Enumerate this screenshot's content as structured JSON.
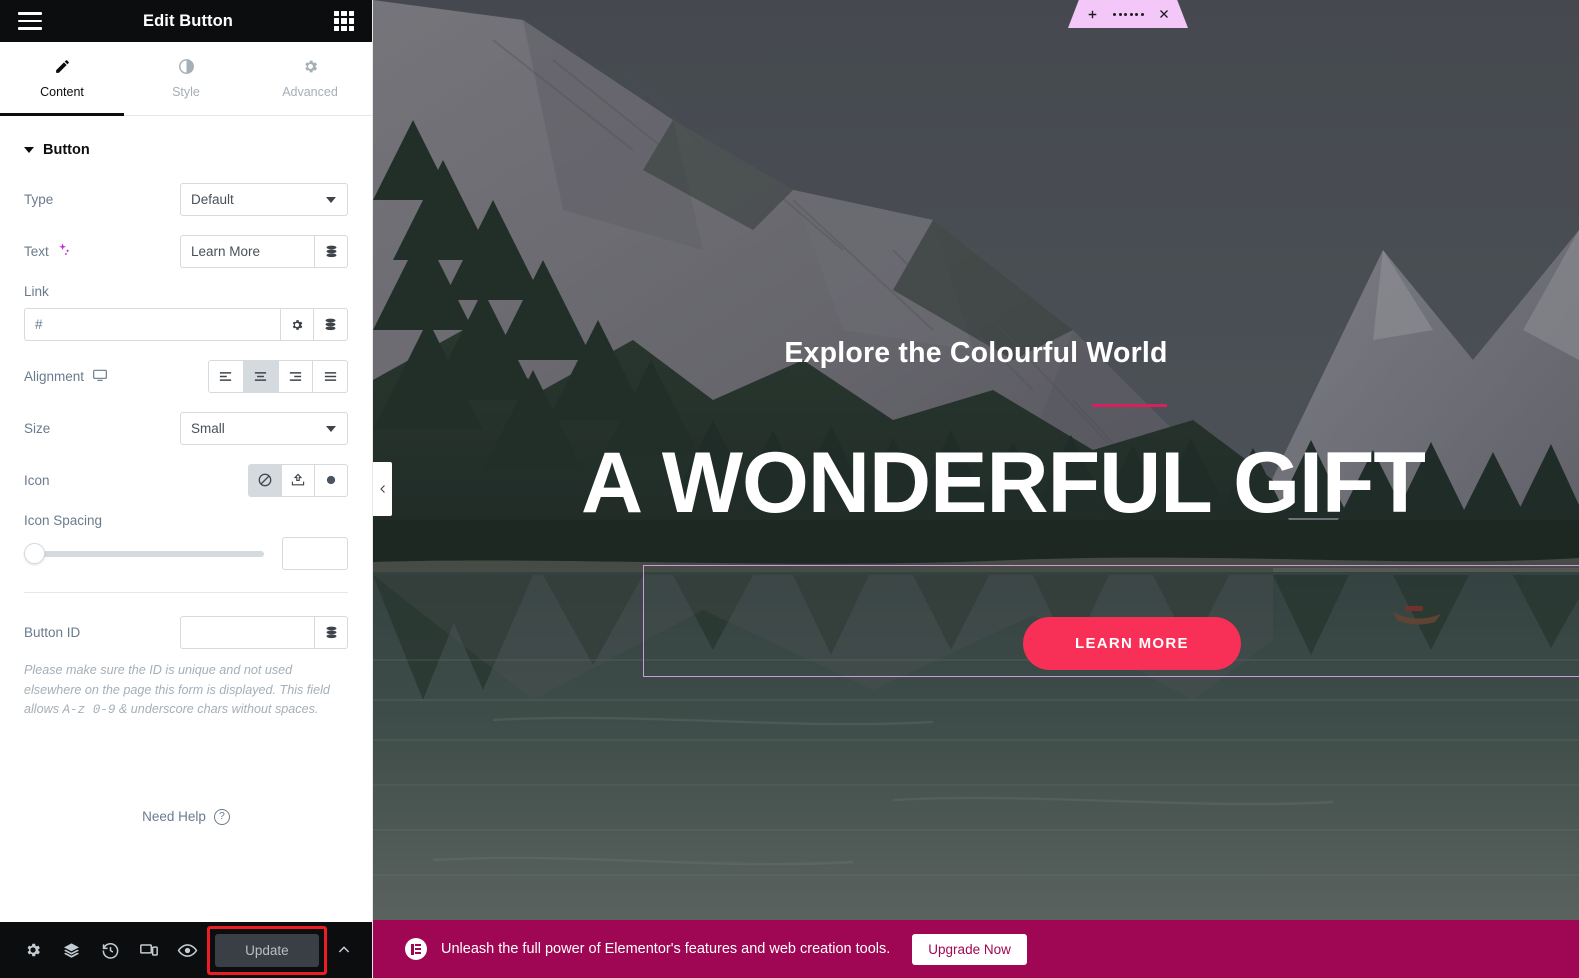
{
  "sidebar": {
    "header": {
      "title": "Edit Button",
      "menu_icon": "hamburger-icon",
      "apps_icon": "grid-apps-icon"
    },
    "tabs": [
      {
        "label": "Content",
        "icon": "pencil-icon",
        "active": true
      },
      {
        "label": "Style",
        "icon": "contrast-half-circle-icon",
        "active": false
      },
      {
        "label": "Advanced",
        "icon": "gear-icon",
        "active": false
      }
    ],
    "section": {
      "title": "Button",
      "expanded": true
    },
    "fields": {
      "type": {
        "label": "Type",
        "value": "Default"
      },
      "text": {
        "label": "Text",
        "value": "Learn More",
        "ai_icon": "ai-sparkles-icon",
        "dynamic_icon": "dynamic-tags-icon"
      },
      "link": {
        "label": "Link",
        "value": "#",
        "settings_icon": "gear-icon",
        "dynamic_icon": "dynamic-tags-icon"
      },
      "alignment": {
        "label": "Alignment",
        "device_icon": "desktop-icon",
        "options": [
          "align-left",
          "align-center",
          "align-right",
          "align-justify"
        ],
        "selected": "align-center"
      },
      "size": {
        "label": "Size",
        "value": "Small"
      },
      "icon": {
        "label": "Icon",
        "options": [
          "icon-none-ban",
          "icon-upload",
          "icon-circle"
        ],
        "selected": "icon-none-ban"
      },
      "icon_spacing": {
        "label": "Icon Spacing",
        "value": "",
        "slider_position_percent": 0
      },
      "button_id": {
        "label": "Button ID",
        "value": "",
        "placeholder": "",
        "dynamic_icon": "dynamic-tags-icon"
      }
    },
    "help_text": {
      "part1": "Please make sure the ID is unique and not used elsewhere on the page this form is displayed. This field allows",
      "mono": "A-z 0-9",
      "part2": "& underscore chars without spaces."
    },
    "need_help": {
      "label": "Need Help",
      "icon": "question-circle-icon"
    },
    "footer": {
      "icons": [
        "gear-icon",
        "layers-icon",
        "history-revisions-icon",
        "responsive-device-icon",
        "eye-preview-icon"
      ],
      "update_label": "Update",
      "update_highlight_color": "#ee1c25",
      "expand_icon": "chevron-up-icon"
    }
  },
  "canvas": {
    "section_toolbar": {
      "add_icon": "plus-icon",
      "drag_icon": "drag-dots-icon",
      "close_icon": "close-x-icon",
      "color": "#f3c7f7"
    },
    "collapse_panel": {
      "icon": "chevron-left-icon"
    },
    "hero": {
      "subtitle": "Explore the Colourful World",
      "divider_color": "#d6215c",
      "title": "A WONDERFUL GIFT",
      "button_label": "LEARN MORE",
      "button_color": "#f82f56",
      "selection_outline_color": "#cb9ad9"
    }
  },
  "promo": {
    "logo_icon": "elementor-logo-icon",
    "message": "Unleash the full power of Elementor's features and web creation tools.",
    "button_label": "Upgrade Now",
    "background_color": "#9f0654"
  }
}
